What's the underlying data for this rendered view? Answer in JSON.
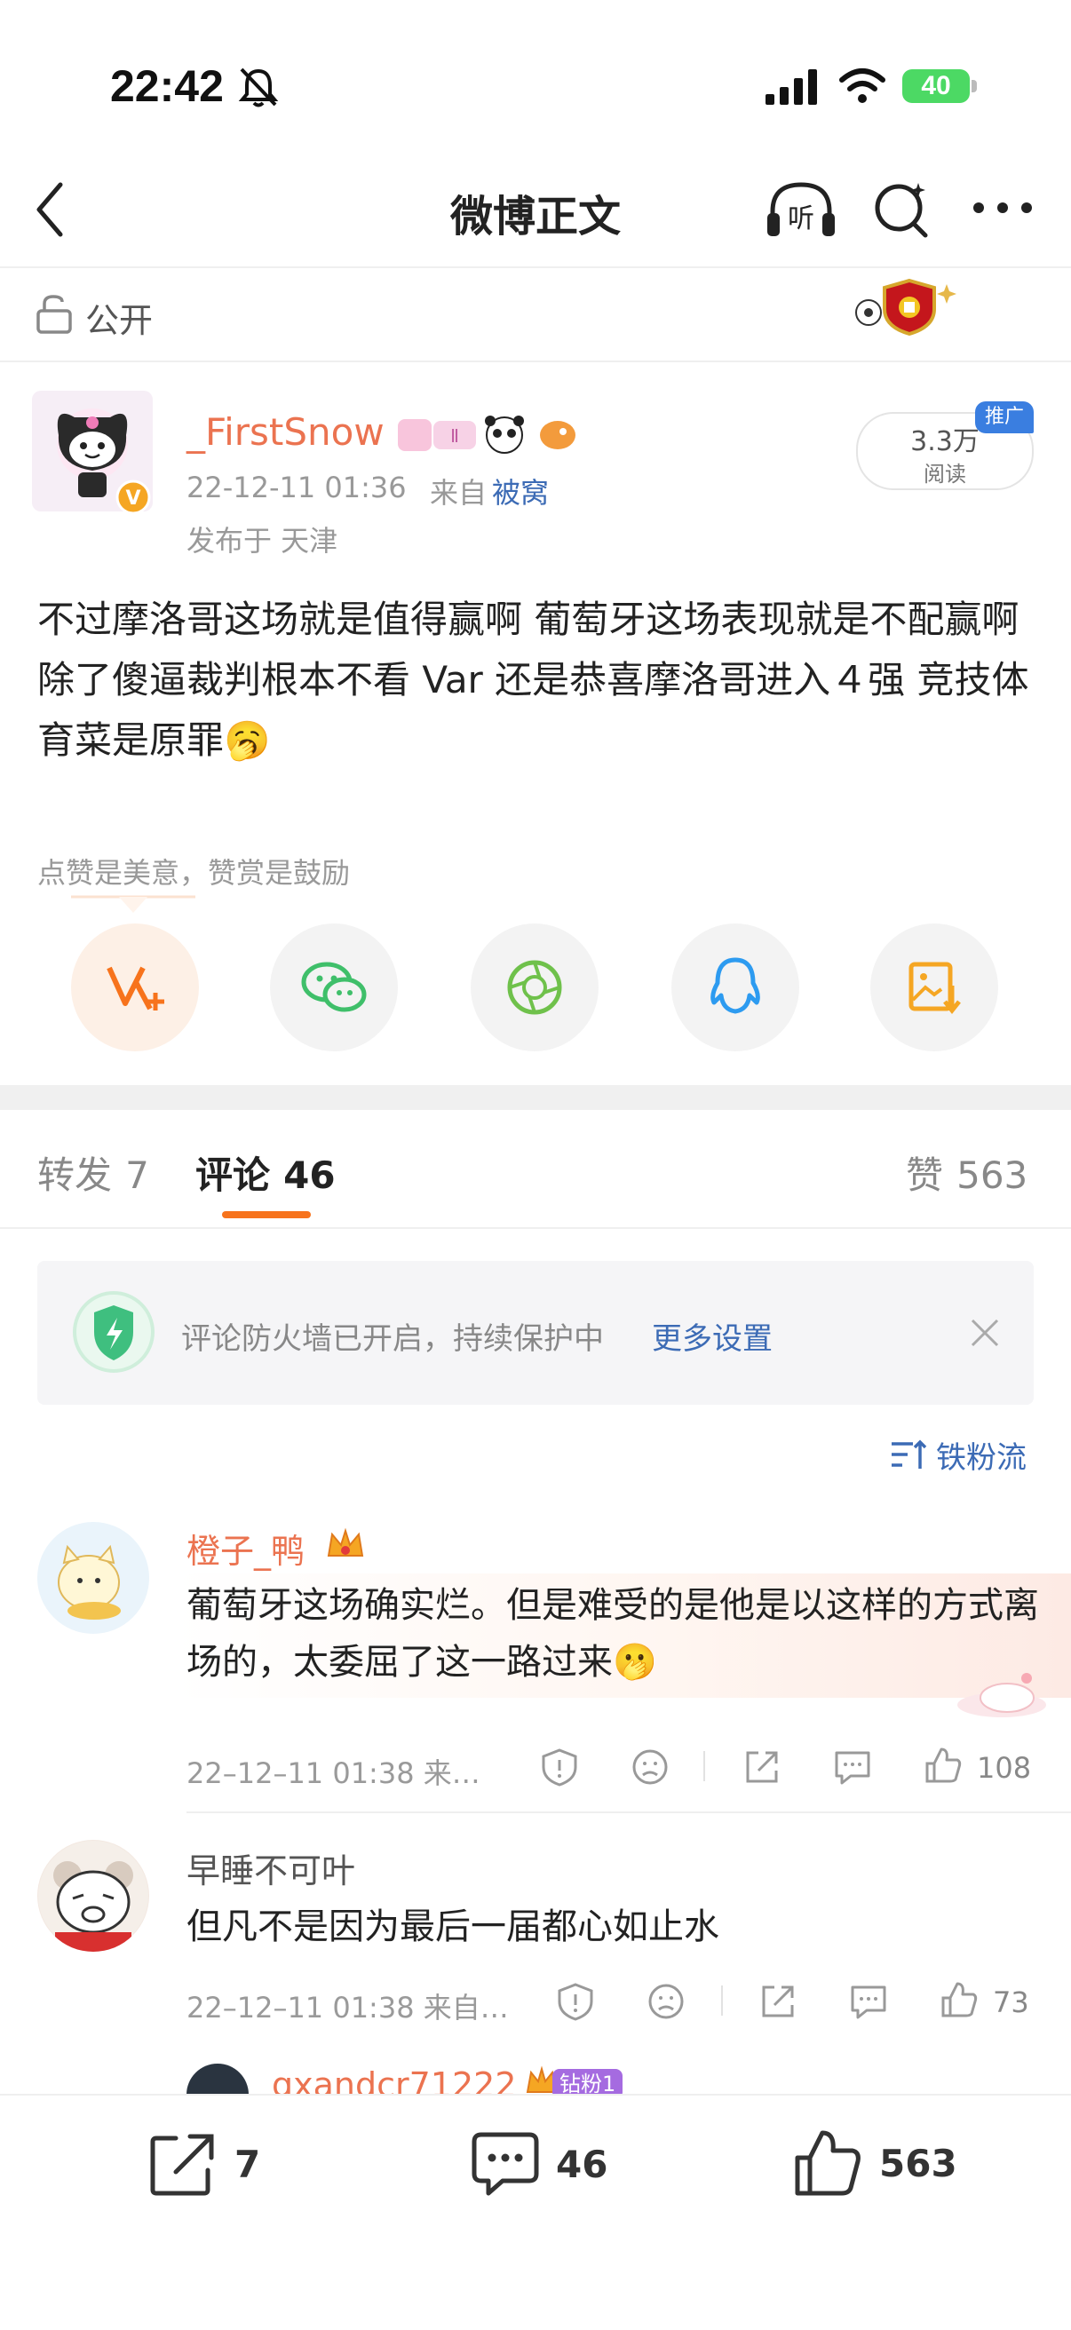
{
  "status_bar": {
    "time": "22:42",
    "battery": "40"
  },
  "nav": {
    "title": "微博正文"
  },
  "visibility": {
    "label": "公开"
  },
  "post": {
    "author": "_FirstSnow",
    "timestamp": "22-12-11 01:36",
    "source_prefix": "来自",
    "source": "被窝",
    "location": "发布于 天津",
    "views_count": "3.3万",
    "views_label": "阅读",
    "promo_badge": "推广",
    "text": "不过摩洛哥这场就是值得赢啊 葡萄牙这场表现就是不配赢啊 除了傻逼裁判根本不看 Var 还是恭喜摩洛哥进入４强 竞技体育菜是原罪🥱",
    "reward_hint": "点赞是美意，赞赏是鼓励"
  },
  "tabs": {
    "repost_label": "转发",
    "repost_count": "7",
    "comment_label": "评论",
    "comment_count": "46",
    "like_label": "赞",
    "like_count": "563"
  },
  "firewall": {
    "text": "评论防火墙已开启，持续保护中",
    "link": "更多设置"
  },
  "sort": {
    "label": "铁粉流"
  },
  "comments": [
    {
      "name": "橙子_鸭",
      "text": "葡萄牙这场确实烂。但是难受的是他是以这样的方式离场的，太委屈了这一路过来🫢",
      "meta": "22–12–11 01:38  来…",
      "likes": "108"
    },
    {
      "name": "早睡不可叶",
      "text": "但凡不是因为最后一届都心如止水",
      "meta": "22–12–11 01:38  来自…",
      "likes": "73"
    },
    {
      "name": "gxandcr71222",
      "badge": "钻粉1"
    }
  ],
  "bottom_bar": {
    "repost": "7",
    "comment": "46",
    "like": "563"
  },
  "colors": {
    "accent": "#f7731c",
    "link": "#3c6bb5",
    "name_orange": "#eb7350"
  }
}
